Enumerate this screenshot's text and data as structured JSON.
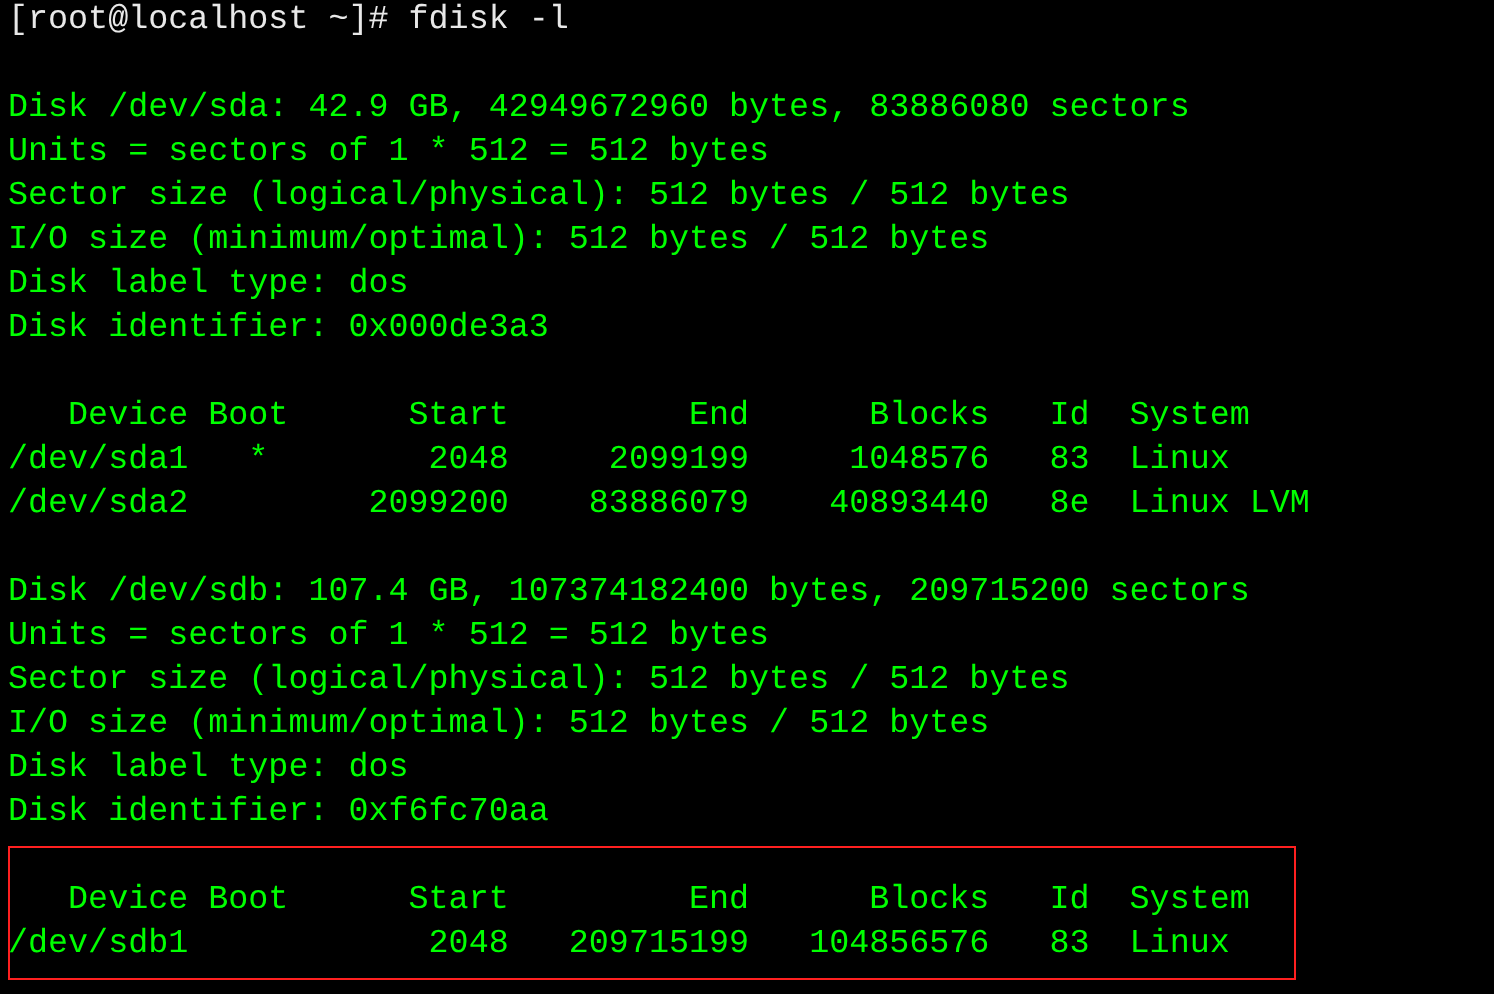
{
  "sections": [
    {
      "highlighted": false,
      "lines": [
        {
          "kind": "prompt",
          "text": "[root@localhost ~]# fdisk -l"
        }
      ]
    },
    {
      "highlighted": false,
      "lines": [
        {
          "kind": "output",
          "text": "Disk /dev/sda: 42.9 GB, 42949672960 bytes, 83886080 sectors"
        },
        {
          "kind": "output",
          "text": "Units = sectors of 1 * 512 = 512 bytes"
        },
        {
          "kind": "output",
          "text": "Sector size (logical/physical): 512 bytes / 512 bytes"
        },
        {
          "kind": "output",
          "text": "I/O size (minimum/optimal): 512 bytes / 512 bytes"
        },
        {
          "kind": "output",
          "text": "Disk label type: dos"
        },
        {
          "kind": "output",
          "text": "Disk identifier: 0x000de3a3"
        }
      ]
    },
    {
      "highlighted": false,
      "lines": [
        {
          "kind": "output",
          "text": "   Device Boot      Start         End      Blocks   Id  System"
        },
        {
          "kind": "output",
          "text": "/dev/sda1   *        2048     2099199     1048576   83  Linux"
        },
        {
          "kind": "output",
          "text": "/dev/sda2         2099200    83886079    40893440   8e  Linux LVM"
        }
      ]
    },
    {
      "highlighted": false,
      "lines": [
        {
          "kind": "output",
          "text": "Disk /dev/sdb: 107.4 GB, 107374182400 bytes, 209715200 sectors"
        },
        {
          "kind": "output",
          "text": "Units = sectors of 1 * 512 = 512 bytes"
        },
        {
          "kind": "output",
          "text": "Sector size (logical/physical): 512 bytes / 512 bytes"
        },
        {
          "kind": "output",
          "text": "I/O size (minimum/optimal): 512 bytes / 512 bytes"
        },
        {
          "kind": "output",
          "text": "Disk label type: dos"
        },
        {
          "kind": "output",
          "text": "Disk identifier: 0xf6fc70aa"
        }
      ]
    },
    {
      "highlighted": true,
      "lines": [
        {
          "kind": "output",
          "text": "   Device Boot      Start         End      Blocks   Id  System"
        },
        {
          "kind": "output",
          "text": "/dev/sdb1            2048   209715199   104856576   83  Linux"
        }
      ]
    }
  ]
}
